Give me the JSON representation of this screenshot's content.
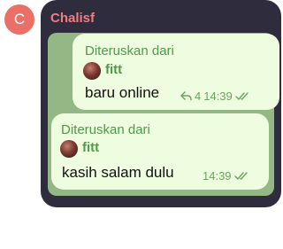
{
  "chat": {
    "avatar_letter": "C",
    "sender_name": "Chalisf"
  },
  "messages": [
    {
      "forwarded_label": "Diteruskan dari",
      "forwarded_from": "fitt",
      "text": "baru online",
      "reply_count": "4",
      "time": "14:39",
      "status": "read"
    },
    {
      "forwarded_label": "Diteruskan dari",
      "forwarded_from": "fitt",
      "text": "kasih salam dulu",
      "time": "14:39",
      "status": "read"
    }
  ],
  "colors": {
    "accent": "#4e9a49",
    "sender": "#ef7e80",
    "avatar": "#ea6f66",
    "bubble": "#eefcdf",
    "card": "#2f2c3e"
  }
}
